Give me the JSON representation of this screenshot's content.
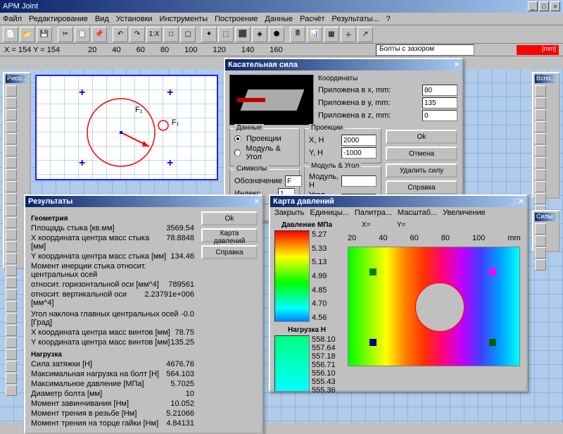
{
  "app": {
    "title": "APM Joint"
  },
  "menu": [
    "Файл",
    "Редактирование",
    "Вид",
    "Установки",
    "Инструменты",
    "Построение",
    "Данные",
    "Расчёт",
    "Результаты...",
    "?"
  ],
  "status": {
    "coords": "X = 154  Y = 154",
    "combo": "Болты с зазором"
  },
  "ruler": [
    "20",
    "40",
    "60",
    "80",
    "100",
    "120",
    "140",
    "160"
  ],
  "ruler2": [
    "20",
    "40",
    "60",
    "80",
    "100"
  ],
  "draw": {
    "f1a": "F₁",
    "f1b": "F₁"
  },
  "tangent": {
    "title": "Касательная сила",
    "coords_label": "Координаты",
    "px_label": "Приложена в x, mm:",
    "px": "80",
    "py_label": "Приложена в y, mm:",
    "py": "135",
    "pz_label": "Приложена в z, mm:",
    "pz": "0",
    "groups": {
      "data": "Данные",
      "proj": "Проекции",
      "sym": "Символы",
      "ma": "Модуль & Угол"
    },
    "radio_proj": "Проекции",
    "radio_ma": "Модуль & Угол",
    "xh_label": "X, H",
    "xh": "2000",
    "yh_label": "Y, H",
    "yh": "-1000",
    "obz_label": "Обозначение",
    "obz": "F",
    "idx_label": "Индекс",
    "idx": "1",
    "mod_label": "Модуль, H",
    "mod": "",
    "ang_label": "Угол, Град",
    "ang": "",
    "ok": "Ok",
    "cancel": "Отмена",
    "delete": "Удалить силу",
    "help": "Справка"
  },
  "results": {
    "title": "Результаты",
    "ok": "Ok",
    "map": "Карта давлений",
    "help": "Справка",
    "geom": "Геометрия",
    "r": [
      [
        "Площадь стыка [кв.мм]",
        "3569.54"
      ],
      [
        "X координата центра масс стыка [мм]",
        "78.8848"
      ],
      [
        "Y координата центра масс стыка [мм]",
        "134.46"
      ],
      [
        "Момент инерции стыка относит. центральных осей",
        ""
      ],
      [
        "относит. горизонтальной оси [мм^4]",
        "789561"
      ],
      [
        "относит. вертикальной оси [мм^4]",
        "2.23791e+006"
      ],
      [
        "",
        ""
      ],
      [
        "Угол наклона главных центральных осей [Град]",
        "-0.0"
      ],
      [
        "X координата центра масс винтов [мм]",
        "78.75"
      ],
      [
        "Y координата центра масс винтов [мм]",
        "135.25"
      ]
    ],
    "load": "Нагрузка",
    "r2": [
      [
        "Сила затяжки [Н]",
        "4676.76"
      ],
      [
        "Максимальная нагрузка на болт [Н]",
        "564.103"
      ],
      [
        "Максимальное давление [МПа]",
        "5.7025"
      ],
      [
        "Диаметр болта [мм]",
        "10"
      ],
      [
        "Момент завинчивания [Нм]",
        "10.052"
      ],
      [
        "Момент трения в резьбе [Нм]",
        "5.21066"
      ],
      [
        "Момент трения на торце гайки [Нм]",
        "4.84131"
      ]
    ]
  },
  "pmap": {
    "title": "Карта давлений",
    "menu": [
      "Закрыть",
      "Единицы...",
      "Палитра...",
      "Масштаб...",
      "Увеличение"
    ],
    "p_label": "Давление МПа",
    "p_vals": [
      "5.27",
      "5.33",
      "5.13",
      "4.99",
      "4.85",
      "4.70",
      "4.56"
    ],
    "n_label": "Нагрузка Н",
    "n_vals": [
      "558.10",
      "557.64",
      "557.18",
      "556.71",
      "556.10",
      "555.43",
      "555.36"
    ],
    "x": "X=",
    "y": "Y="
  }
}
